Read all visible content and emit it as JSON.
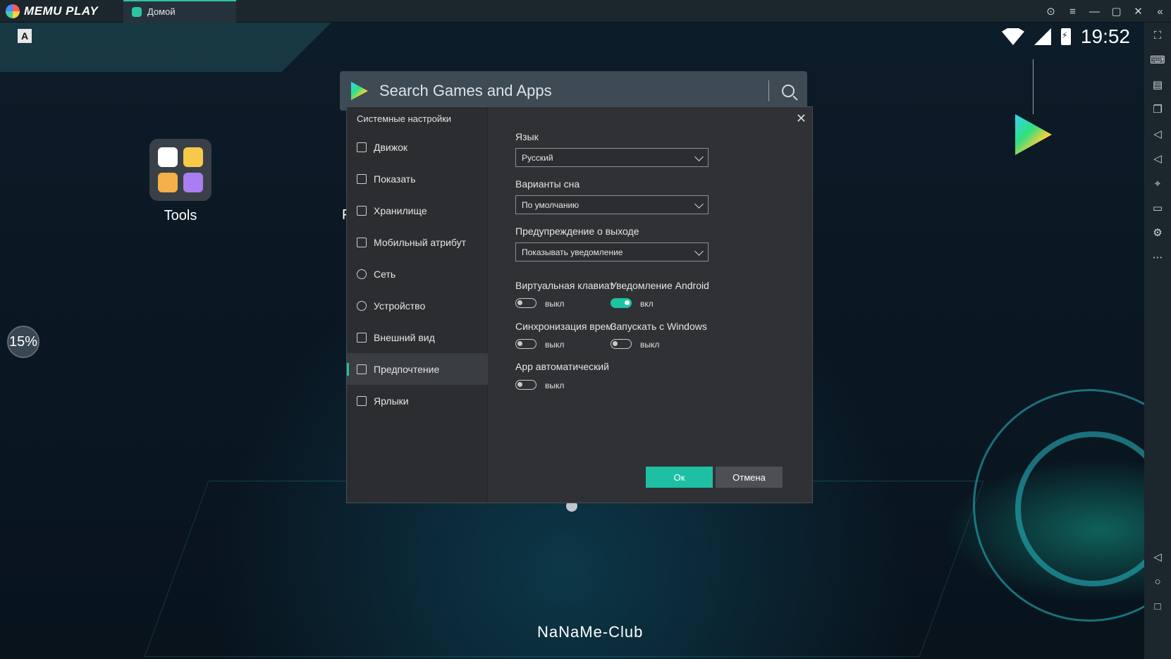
{
  "app": {
    "logo_text": "MEMU PLAY",
    "tab_label": "Домой"
  },
  "window": {
    "controls": [
      "⊙",
      "≡",
      "—",
      "▢",
      "✕"
    ],
    "collapse": "«"
  },
  "status": {
    "clock": "19:52"
  },
  "desktop": {
    "keyboard_letter": "A",
    "tools_label": "Tools",
    "partial_label": "F",
    "percent_badge": "15%",
    "watermark": "NaNaMe-Club"
  },
  "search": {
    "placeholder": "Search Games and Apps"
  },
  "dialog": {
    "title": "Системные настройки",
    "menu": [
      {
        "label": "Движок",
        "icon": "engine-icon"
      },
      {
        "label": "Показать",
        "icon": "display-icon"
      },
      {
        "label": "Хранилище",
        "icon": "storage-icon"
      },
      {
        "label": "Мобильный атрибут",
        "icon": "tag-icon"
      },
      {
        "label": "Сеть",
        "icon": "globe-icon"
      },
      {
        "label": "Устройство",
        "icon": "microphone-icon"
      },
      {
        "label": "Внешний вид",
        "icon": "window-icon"
      },
      {
        "label": "Предпочтение",
        "icon": "wrench-icon",
        "active": true
      },
      {
        "label": "Ярлыки",
        "icon": "keyboard-icon"
      }
    ],
    "language": {
      "label": "Язык",
      "value": "Русский"
    },
    "sleep": {
      "label": "Варианты сна",
      "value": "По умолчанию"
    },
    "exit_warning": {
      "label": "Предупреждение о выходе",
      "value": "Показывать уведомление"
    },
    "virtual_keyboard": {
      "label": "Виртуальная клавиат",
      "state": "выкл"
    },
    "android_notify": {
      "label": "Уведомление Android",
      "state": "вкл"
    },
    "time_sync": {
      "label": "Синхронизация врем",
      "state": "выкл"
    },
    "start_with_windows": {
      "label": "Запускать с Windows",
      "state": "выкл"
    },
    "app_auto": {
      "label": "App автоматический",
      "state": "выкл"
    },
    "ok_label": "Ок",
    "cancel_label": "Отмена"
  },
  "colors": {
    "accent": "#1fc3a0",
    "dialog_bg": "#2f3134",
    "titlebar": "#1c262d"
  }
}
